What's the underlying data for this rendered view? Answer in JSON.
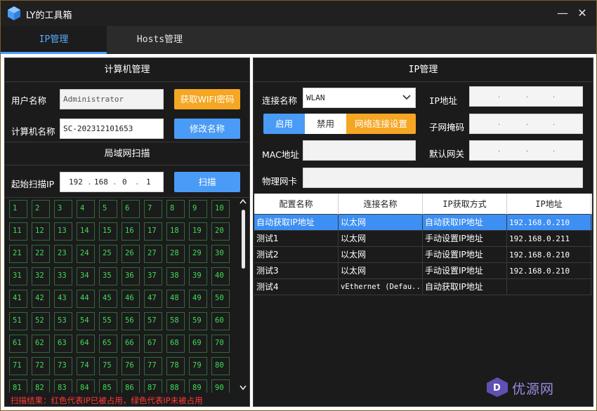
{
  "window": {
    "title": "LY的工具箱",
    "minimize_glyph": "—",
    "close_glyph": "✕"
  },
  "tabs": [
    {
      "label": "IP管理",
      "active": true
    },
    {
      "label": "Hosts管理",
      "active": false
    }
  ],
  "left": {
    "computer_section": "计算机管理",
    "user_label": "用户名称",
    "user_value": "Administrator",
    "wifi_button": "获取WIFI密码",
    "computer_label": "计算机名称",
    "computer_value": "SC-202312101653",
    "rename_button": "修改名称",
    "lan_section": "局域网扫描",
    "start_ip_label": "起始扫描IP",
    "ip_parts": [
      "192",
      "168",
      "0",
      "1"
    ],
    "scan_button": "扫描",
    "cells": [
      "1",
      "2",
      "3",
      "4",
      "5",
      "6",
      "7",
      "8",
      "9",
      "10",
      "11",
      "12",
      "13",
      "14",
      "15",
      "16",
      "17",
      "18",
      "19",
      "20",
      "21",
      "22",
      "23",
      "24",
      "25",
      "26",
      "27",
      "28",
      "29",
      "30",
      "31",
      "32",
      "33",
      "34",
      "35",
      "36",
      "37",
      "38",
      "39",
      "40",
      "41",
      "42",
      "43",
      "44",
      "45",
      "46",
      "47",
      "48",
      "49",
      "50",
      "51",
      "52",
      "53",
      "54",
      "55",
      "56",
      "57",
      "58",
      "59",
      "60",
      "61",
      "62",
      "63",
      "64",
      "65",
      "66",
      "67",
      "68",
      "69",
      "70",
      "71",
      "72",
      "73",
      "74",
      "75",
      "76",
      "77",
      "78",
      "79",
      "80",
      "81",
      "82",
      "83",
      "84",
      "85",
      "86",
      "87",
      "88",
      "89",
      "90"
    ],
    "status": "扫描结果：红色代表IP已被占用，绿色代表IP未被占用"
  },
  "right": {
    "section": "IP管理",
    "conn_label": "连接名称",
    "conn_value": "WLAN",
    "ip_label": "IP地址",
    "enable": "启用",
    "disable": "禁用",
    "netset": "网络连接设置",
    "mask_label": "子网掩码",
    "mac_label": "MAC地址",
    "gateway_label": "默认网关",
    "nic_label": "物理网卡",
    "table_headers": [
      "配置名称",
      "连接名称",
      "IP获取方式",
      "IP地址"
    ],
    "rows": [
      [
        "自动获取IP地址",
        "以太网",
        "自动获取IP地址",
        "192.168.0.210"
      ],
      [
        "测试1",
        "以太网",
        "手动设置IP地址",
        "192.168.0.211"
      ],
      [
        "测试2",
        "以太网",
        "手动设置IP地址",
        "192.168.0.210"
      ],
      [
        "测试3",
        "以太网",
        "手动设置IP地址",
        "192.168.0.210"
      ],
      [
        "测试4",
        "vEthernet (Defau...",
        "自动获取IP地址",
        ""
      ]
    ]
  },
  "watermark": {
    "text": "优源网"
  },
  "colors": {
    "accent": "#4a9bf5",
    "orange": "#f5a623",
    "free_ip": "#3dde55",
    "warn": "#ff3b3b"
  }
}
